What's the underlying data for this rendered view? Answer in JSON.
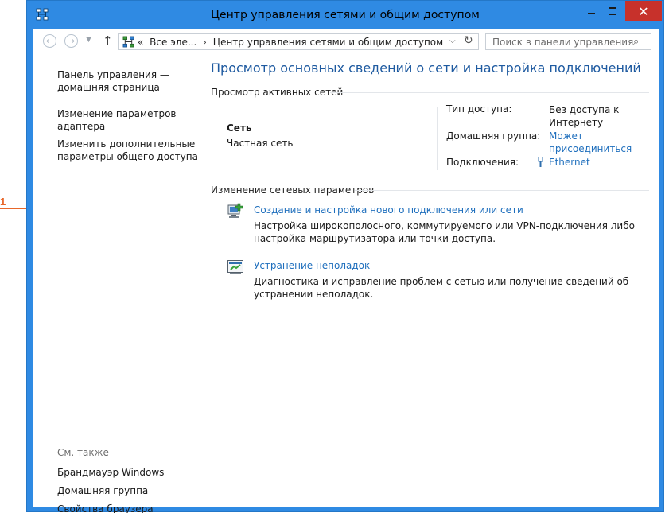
{
  "annotation": {
    "number": "1"
  },
  "window": {
    "title": "Центр управления сетями и общим доступом",
    "icon": "network-center-icon",
    "close_glyph": "✕"
  },
  "navbar": {
    "back_glyph": "←",
    "forward_glyph": "→",
    "history_glyph": "▼",
    "up_glyph": "↑",
    "address_prefix": "«",
    "address_crumb1": "Все эле...",
    "address_sep": "›",
    "address_crumb2": "Центр управления сетями и общим доступом",
    "dropdown_glyph": "⌵",
    "refresh_glyph": "↻",
    "search_placeholder": "Поиск в панели управления",
    "search_glyph": "⌕"
  },
  "sidebar": {
    "links": [
      "Панель управления — домашняя страница",
      "Изменение параметров адаптера",
      "Изменить дополнительные параметры общего доступа"
    ],
    "see_also_label": "См. также",
    "see_also": [
      "Брандмауэр Windows",
      "Домашняя группа",
      "Свойства браузера"
    ]
  },
  "main": {
    "title": "Просмотр основных сведений о сети и настройка подключений",
    "active_networks_header": "Просмотр активных сетей",
    "network": {
      "name": "Сеть",
      "type": "Частная сеть"
    },
    "details": {
      "access_label": "Тип доступа:",
      "access_value": "Без доступа к Интернету",
      "homegroup_label": "Домашняя группа:",
      "homegroup_value": "Может присоединиться",
      "connections_label": "Подключения:",
      "connections_value": "Ethernet"
    },
    "change_header": "Изменение сетевых параметров",
    "tasks": [
      {
        "title": "Создание и настройка нового подключения или сети",
        "description": "Настройка широкополосного, коммутируемого или VPN-подключения либо настройка маршрутизатора или точки доступа.",
        "icon": "new-connection-icon"
      },
      {
        "title": "Устранение неполадок",
        "description": "Диагностика и исправление проблем с сетью или получение сведений об устранении неполадок.",
        "icon": "troubleshoot-icon"
      }
    ]
  },
  "colors": {
    "frame": "#2f8ae3",
    "close_button": "#c7312b",
    "link": "#1f6fbd",
    "title": "#1e5aa0",
    "annotation": "#e8672a"
  }
}
